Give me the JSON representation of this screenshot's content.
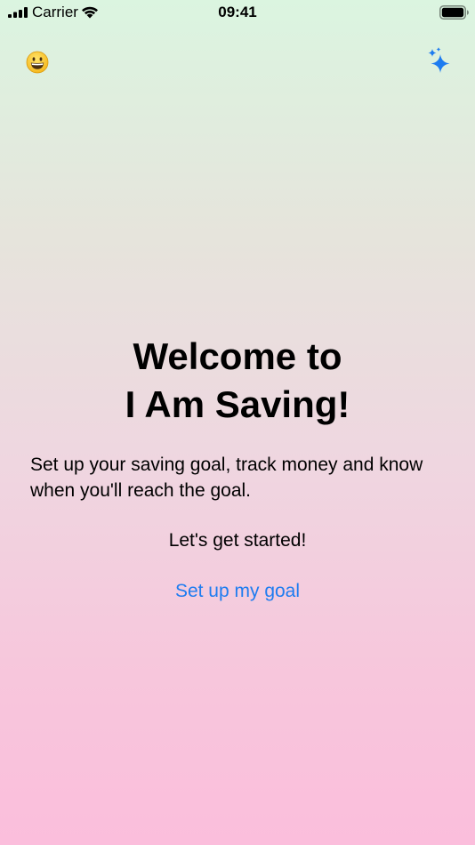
{
  "status_bar": {
    "carrier": "Carrier",
    "time": "09:41",
    "signal_icon": "cellular-signal-icon",
    "wifi_icon": "wifi-icon",
    "battery_icon": "battery-full-icon"
  },
  "toolbar": {
    "left_icon": "grinning-face-icon",
    "right_icon": "sparkles-icon",
    "accent_color": "#1e7cf0"
  },
  "welcome": {
    "title_line1": "Welcome to",
    "title_line2": "I Am Saving!",
    "description": "Set up your saving goal, track money and know when you'll reach the goal.",
    "started": "Let's get started!",
    "setup_link": "Set up my goal"
  },
  "colors": {
    "gradient_top": "#dbf5e0",
    "gradient_bottom": "#fbbedc",
    "link": "#1e7cf0"
  }
}
